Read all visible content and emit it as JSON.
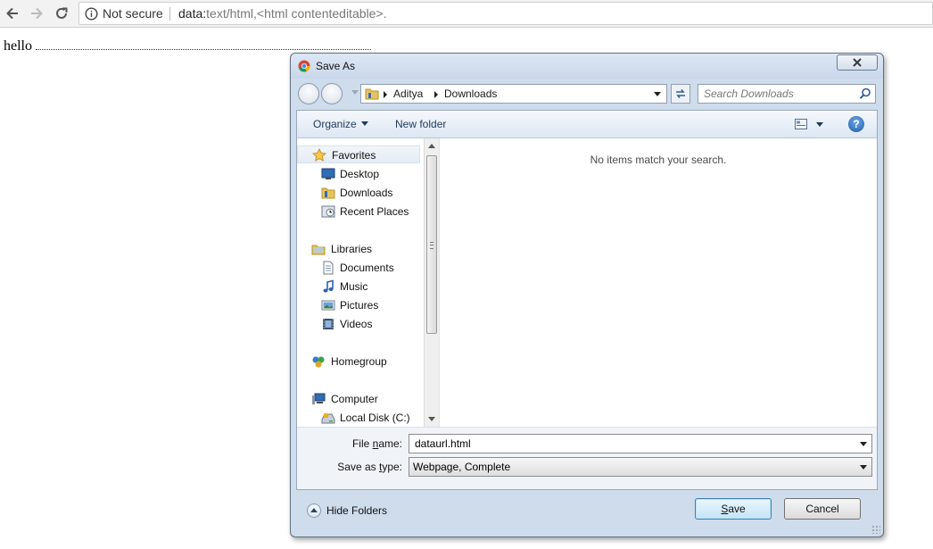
{
  "browser": {
    "security_label": "Not secure",
    "url_scheme": "data:",
    "url_rest": "text/html,<html contenteditable>."
  },
  "page": {
    "text": "hello"
  },
  "dialog": {
    "title": "Save As",
    "breadcrumb": [
      "Aditya",
      "Downloads"
    ],
    "search_placeholder": "Search Downloads",
    "toolbar": {
      "organize": "Organize",
      "new_folder": "New folder",
      "help": "?"
    },
    "nav": {
      "favorites": "Favorites",
      "desktop": "Desktop",
      "downloads": "Downloads",
      "recent_places": "Recent Places",
      "libraries": "Libraries",
      "documents": "Documents",
      "music": "Music",
      "pictures": "Pictures",
      "videos": "Videos",
      "homegroup": "Homegroup",
      "computer": "Computer",
      "local_disk": "Local Disk (C:)"
    },
    "empty_message": "No items match your search.",
    "file_name": {
      "label_prefix": "File ",
      "label_underlined": "n",
      "label_suffix": "ame:",
      "value": "dataurl.html"
    },
    "save_type": {
      "label_prefix": "Save as ",
      "label_underlined": "t",
      "label_suffix": "ype:",
      "value": "Webpage, Complete"
    },
    "hide_folders": "Hide Folders",
    "save_button": {
      "underlined": "S",
      "rest": "ave"
    },
    "cancel_button": "Cancel"
  }
}
